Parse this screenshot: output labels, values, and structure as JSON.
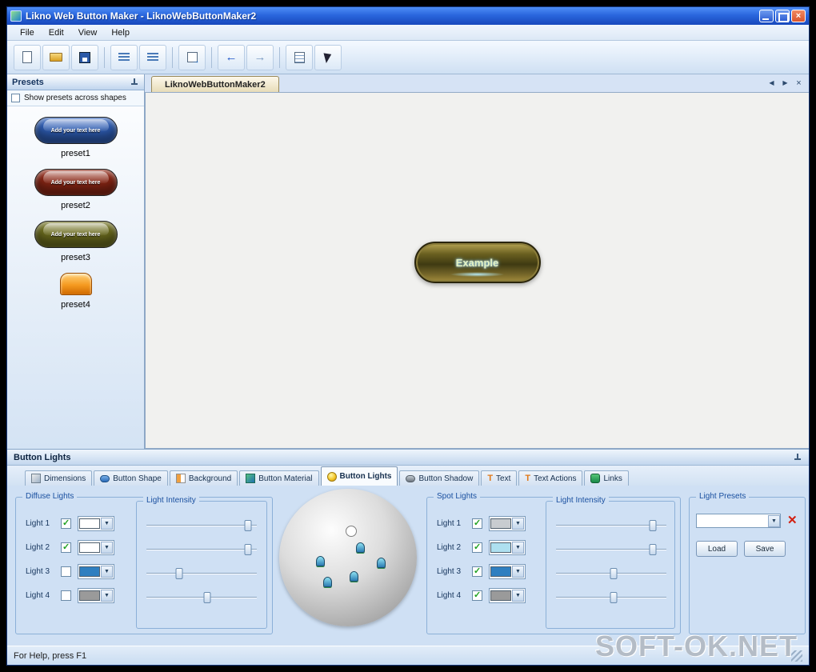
{
  "window": {
    "title": "Likno Web Button Maker - LiknoWebButtonMaker2"
  },
  "menu": {
    "items": [
      "File",
      "Edit",
      "View",
      "Help"
    ]
  },
  "toolbar": {
    "buttons": [
      "new",
      "open",
      "save",
      "list-add",
      "list-remove",
      "export",
      "back",
      "forward",
      "notes",
      "select"
    ]
  },
  "presets_panel": {
    "title": "Presets",
    "show_across_label": "Show presets across shapes",
    "show_across_checked": false,
    "items": [
      {
        "name": "preset1",
        "button_text": "Add your text here",
        "color": "#2f5fb8"
      },
      {
        "name": "preset2",
        "button_text": "Add your text here",
        "color": "#8e2715"
      },
      {
        "name": "preset3",
        "button_text": "Add your text here",
        "color": "#6f6f1f"
      },
      {
        "name": "preset4",
        "button_text": "",
        "color": ""
      }
    ]
  },
  "document": {
    "tab_label": "LiknoWebButtonMaker2",
    "button_text": "Example"
  },
  "bottom": {
    "panel_title": "Button Lights",
    "tabs": [
      {
        "label": "Dimensions",
        "active": false
      },
      {
        "label": "Button Shape",
        "active": false
      },
      {
        "label": "Background",
        "active": false
      },
      {
        "label": "Button Material",
        "active": false
      },
      {
        "label": "Button Lights",
        "active": true
      },
      {
        "label": "Button Shadow",
        "active": false
      },
      {
        "label": "Text",
        "active": false,
        "icon_letter": "T"
      },
      {
        "label": "Text Actions",
        "active": false,
        "icon_letter": "T"
      },
      {
        "label": "Links",
        "active": false,
        "icon_letter": "GO"
      }
    ],
    "diffuse": {
      "title": "Diffuse Lights",
      "intensity_title": "Light Intensity",
      "lights": [
        {
          "label": "Light 1",
          "checked": true,
          "color": "#ffffff",
          "intensity": 92
        },
        {
          "label": "Light 2",
          "checked": true,
          "color": "#ffffff",
          "intensity": 92
        },
        {
          "label": "Light 3",
          "checked": false,
          "color": "#2f7fc0",
          "intensity": 30
        },
        {
          "label": "Light 4",
          "checked": false,
          "color": "#9a9a9a",
          "intensity": 55
        }
      ]
    },
    "spot": {
      "title": "Spot Lights",
      "intensity_title": "Light Intensity",
      "lights": [
        {
          "label": "Light 1",
          "checked": true,
          "color": "#c8ccd0",
          "intensity": 88
        },
        {
          "label": "Light 2",
          "checked": true,
          "color": "#aee0f0",
          "intensity": 88
        },
        {
          "label": "Light 3",
          "checked": true,
          "color": "#2f7fc0",
          "intensity": 52
        },
        {
          "label": "Light 4",
          "checked": true,
          "color": "#9a9a9a",
          "intensity": 52
        }
      ]
    },
    "light_presets": {
      "title": "Light Presets",
      "combo_value": "",
      "load_label": "Load",
      "save_label": "Save"
    }
  },
  "status": {
    "text": "For Help, press F1"
  },
  "watermark": "SOFT-OK.NET",
  "colors": {
    "titlebar_light": "#4e8ef7",
    "titlebar_dark": "#1848bc",
    "close_red": "#d9542c",
    "chrome": "#d6e3f5",
    "canvas": "#f1f1ef",
    "group_title": "#1a50a0",
    "group_border": "#8cb0d8",
    "watermark": "#b4bcc6"
  }
}
